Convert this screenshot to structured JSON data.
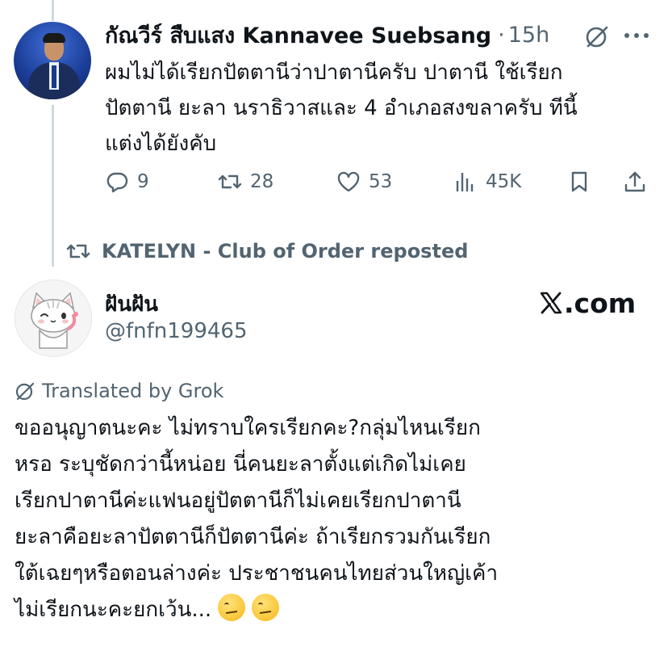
{
  "tweet1": {
    "author_name": "กัณวีร์ สืบแสง Kannavee Suebsang",
    "separator": "·",
    "time": "15h",
    "text_lines": [
      "ผมไม่ได้เรียกปัตตานีว่าปาตานีครับ ปาตานี ใช้เรียก",
      "ปัตตานี ยะลา นราธิวาสและ 4 อำเภอสงขลาครับ ทีนี้",
      "แต่งได้ยังคับ"
    ],
    "actions": {
      "replies": "9",
      "reposts": "28",
      "likes": "53",
      "views": "45K"
    },
    "icons": [
      "grok-icon",
      "more-icon",
      "reply-icon",
      "repost-icon",
      "like-icon",
      "views-icon",
      "bookmark-icon",
      "share-icon"
    ]
  },
  "repost_line": {
    "text": "KATELYN - Club of Order reposted"
  },
  "tweet2": {
    "author_name": "ฝันฝัน",
    "handle": "@fnfn199465",
    "watermark": ".com",
    "translated_label": "Translated by Grok",
    "text_lines": [
      "ขออนุญาตนะคะ ไม่ทราบใครเรียกคะ?กลุ่มไหนเรียก",
      "หรอ ระบุชัดกว่านี้หน่อย นี่คนยะลาตั้งแต่เกิดไม่เคย",
      "เรียกปาตานีค่ะแฟนอยู่ปัตตานีก็ไม่เคยเรียกปาตานี",
      "ยะลาคือยะลาปัตตานีก็ปัตตานีค่ะ ถ้าเรียกรวมกันเรียก",
      "ใต้เฉยๆหรือตอนล่างค่ะ ประชาชนคนไทยส่วนใหญ่เค้า",
      "ไม่เรียกนะคะยกเว้น..."
    ]
  },
  "colors": {
    "text": "#0f1419",
    "secondary": "#536471",
    "thread_line": "#cfd9de"
  }
}
